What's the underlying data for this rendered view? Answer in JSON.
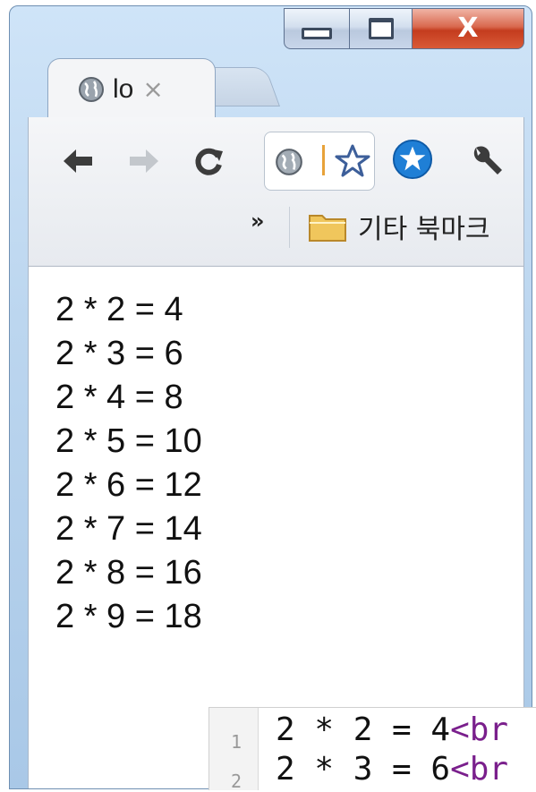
{
  "window": {
    "controls": {
      "minimize": "minimize",
      "maximize": "maximize",
      "close_glyph": "X"
    }
  },
  "tab": {
    "title": "lo",
    "close_glyph": "×",
    "icon": "globe-icon"
  },
  "toolbar": {
    "back_icon": "arrow-left-icon",
    "forward_icon": "arrow-right-icon",
    "reload_icon": "reload-icon",
    "omnibox_icon": "globe-icon",
    "bookmark_star_icon": "star-outline-icon",
    "extension_icon": "star-badge-icon",
    "wrench_icon": "wrench-icon"
  },
  "bookmarks_bar": {
    "overflow_glyph": "»",
    "folder_label": "기타 북마크",
    "folder_icon": "folder-icon"
  },
  "page": {
    "lines": [
      "2 * 2 = 4",
      "2 * 3 = 6",
      "2 * 4 = 8",
      "2 * 5 = 10",
      "2 * 6 = 12",
      "2 * 7 = 14",
      "2 * 8 = 16",
      "2 * 9 = 18"
    ]
  },
  "editor": {
    "rows": [
      {
        "line_number": "1",
        "code": "2 * 2 = 4",
        "tag": "<br"
      },
      {
        "line_number": "2",
        "code": "2 * 3 = 6",
        "tag": "<br"
      }
    ]
  },
  "colors": {
    "extension_blue": "#1f7fd6",
    "close_red": "#c43c1e",
    "tag_purple": "#7a1f8c"
  }
}
